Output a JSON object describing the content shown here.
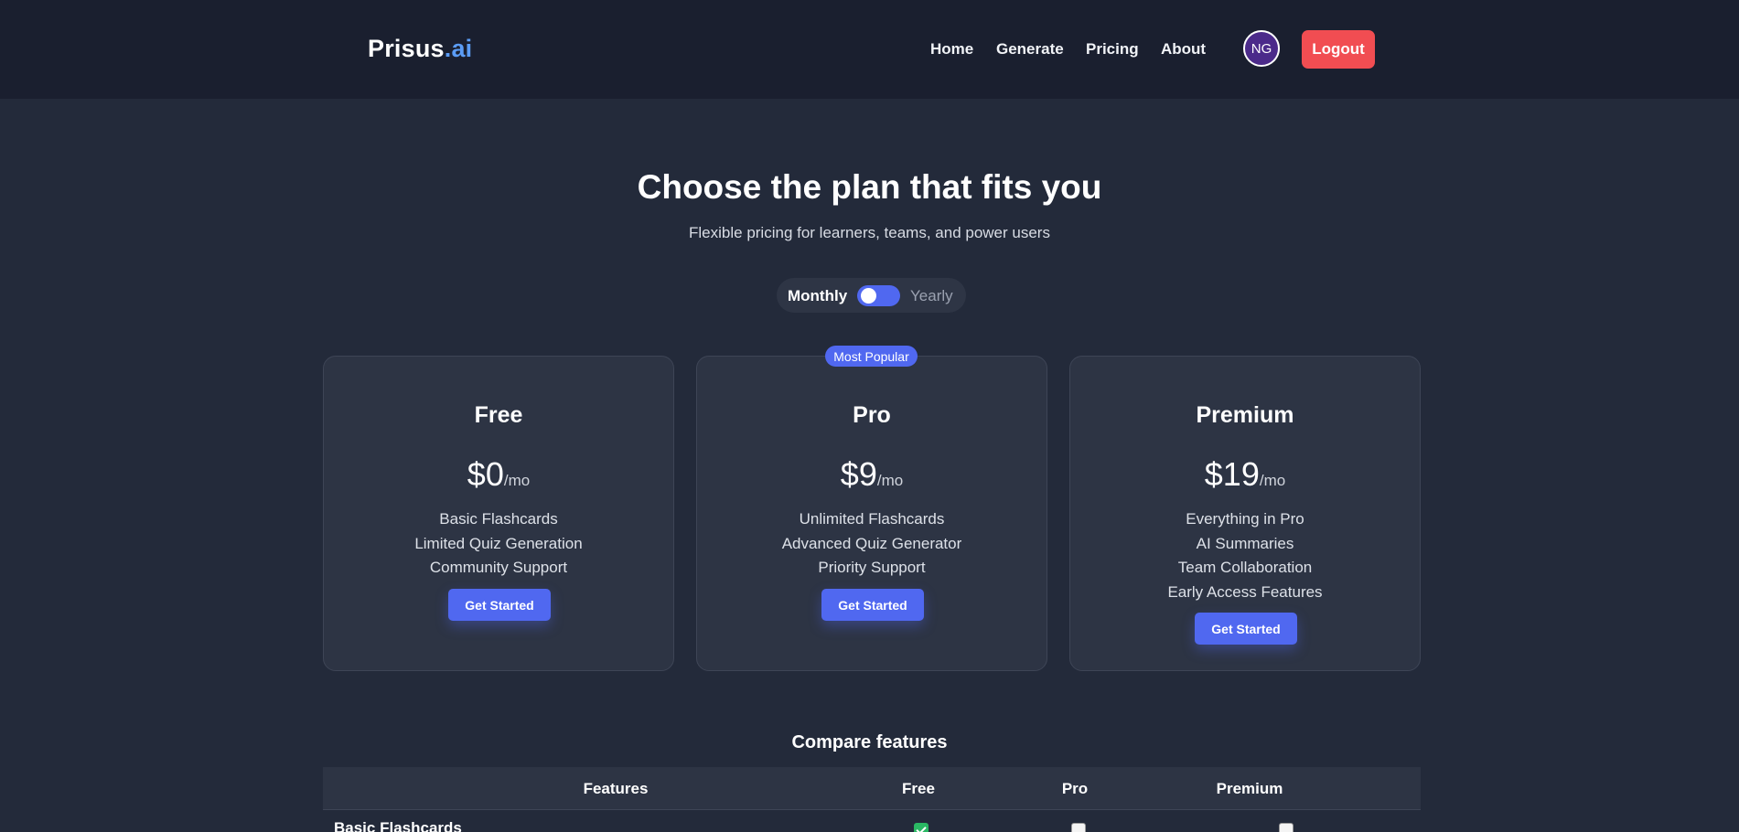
{
  "nav": {
    "brand_main": "Prisus",
    "brand_accent": ".ai",
    "links": [
      "Home",
      "Generate",
      "Pricing",
      "About"
    ],
    "avatar_initials": "NG",
    "logout_label": "Logout"
  },
  "hero": {
    "title": "Choose the plan that fits you",
    "subtitle": "Flexible pricing for learners, teams, and power users"
  },
  "billing_toggle": {
    "monthly_label": "Monthly",
    "yearly_label": "Yearly",
    "selected": "Monthly"
  },
  "plans": [
    {
      "name": "Free",
      "price": "$0",
      "period": "/mo",
      "features": [
        "Basic Flashcards",
        "Limited Quiz Generation",
        "Community Support"
      ],
      "cta": "Get Started"
    },
    {
      "name": "Pro",
      "badge": "Most Popular",
      "price": "$9",
      "period": "/mo",
      "features": [
        "Unlimited Flashcards",
        "Advanced Quiz Generator",
        "Priority Support"
      ],
      "cta": "Get Started"
    },
    {
      "name": "Premium",
      "price": "$19",
      "period": "/mo",
      "features": [
        "Everything in Pro",
        "AI Summaries",
        "Team Collaboration",
        "Early Access Features"
      ],
      "cta": "Get Started"
    }
  ],
  "compare": {
    "title": "Compare features",
    "headers": [
      "Features",
      "Free",
      "Pro",
      "Premium"
    ],
    "rows": [
      {
        "label": "Basic Flashcards",
        "free": true,
        "pro": false,
        "premium": false
      }
    ]
  },
  "colors": {
    "accent": "#5068f0",
    "logout": "#f14d52",
    "background": "#232a3a",
    "navbar": "#1a1f2f",
    "card": "#2d3444",
    "check_on": "#2ab863"
  }
}
